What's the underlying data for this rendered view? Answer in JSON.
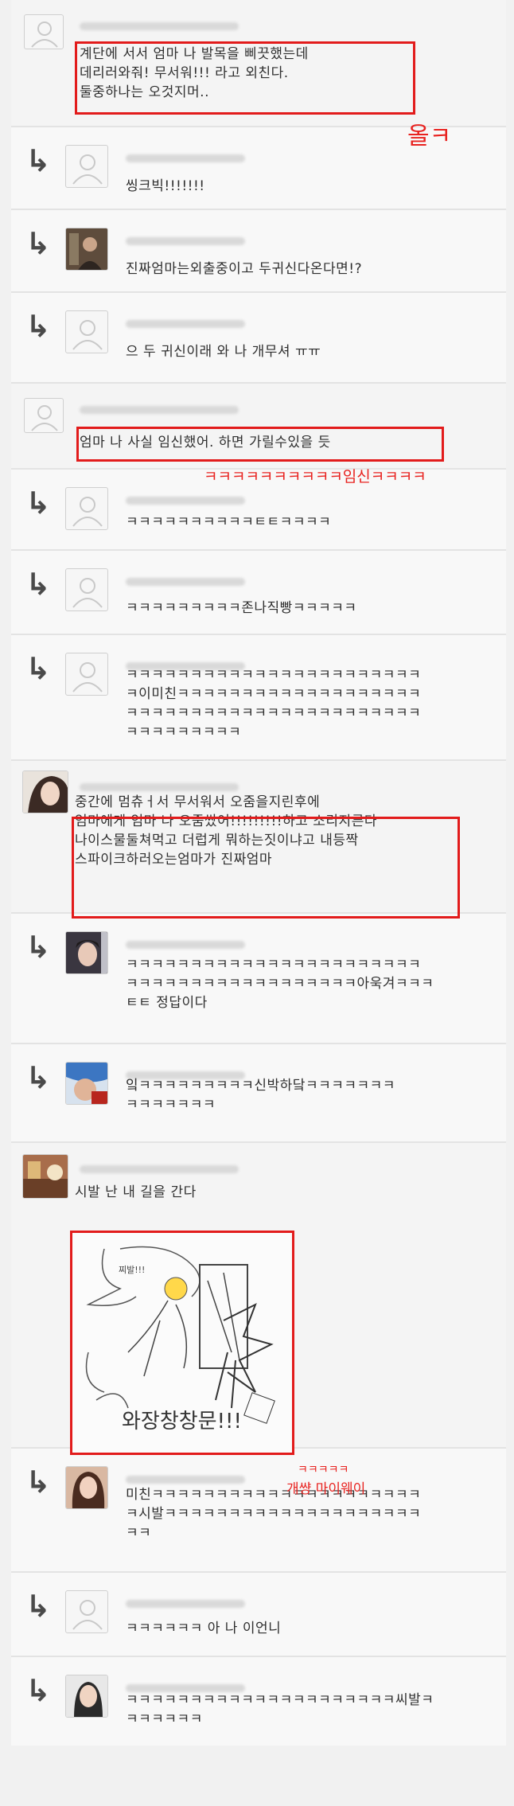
{
  "comments": [
    {
      "type": "top",
      "text": "계단에 서서 엄마 나 발목을 삐끗했는데\n데리러와줘! 무서워!!! 라고 외친다.\n둘중하나는 오것지머.."
    },
    {
      "type": "reply",
      "text": "씽크빅!!!!!!!"
    },
    {
      "type": "reply",
      "text": "진짜엄마는외출중이고 두귀신다온다면!?"
    },
    {
      "type": "reply",
      "text": "으 두 귀신이래 와 나 개무셔 ㅠㅠ"
    },
    {
      "type": "top",
      "text": "엄마 나 사실 임신했어. 하면 가릴수있을 듯"
    },
    {
      "type": "reply",
      "text": "ㅋㅋㅋㅋㅋㅋㅋㅋㅋㅋㅌㅌㅋㅋㅋㅋ"
    },
    {
      "type": "reply",
      "text": "ㅋㅋㅋㅋㅋㅋㅋㅋㅋ존나직빵ㅋㅋㅋㅋㅋ"
    },
    {
      "type": "reply",
      "text": "ㅋㅋㅋㅋㅋㅋㅋㅋㅋㅋㅋㅋㅋㅋㅋㅋㅋㅋㅋㅋㅋㅋㅋ\nㅋ이미친ㅋㅋㅋㅋㅋㅋㅋㅋㅋㅋㅋㅋㅋㅋㅋㅋㅋㅋㅋ\nㅋㅋㅋㅋㅋㅋㅋㅋㅋㅋㅋㅋㅋㅋㅋㅋㅋㅋㅋㅋㅋㅋㅋ\nㅋㅋㅋㅋㅋㅋㅋㅋㅋ"
    },
    {
      "type": "top",
      "text": "중간에 멈츄ㅓ서 무서워서 오줌을지린후에\n엄마에게 엄마 나 오줌쌌어!!!!!!!!!하고 소리지른다\n나이스물둘쳐먹고 더럽게 뭐하는짓이냐고 내등짝\n스파이크하러오는엄마가 진짜엄마"
    },
    {
      "type": "reply",
      "text": "ㅋㅋㅋㅋㅋㅋㅋㅋㅋㅋㅋㅋㅋㅋㅋㅋㅋㅋㅋㅋㅋㅋㅋ\nㅋㅋㅋㅋㅋㅋㅋㅋㅋㅋㅋㅋㅋㅋㅋㅋㅋㅋ아욱겨ㅋㅋㅋ\nㅌㅌ 정답이다"
    },
    {
      "type": "reply",
      "text": "잌ㅋㅋㅋㅋㅋㅋㅋㅋㅋ신박하닼ㅋㅋㅋㅋㅋㅋㅋ\nㅋㅋㅋㅋㅋㅋㅋ"
    },
    {
      "type": "top",
      "text": "시발 난 내 길을 간다"
    },
    {
      "type": "reply",
      "text": "미친ㅋㅋㅋㅋㅋㅋㅋㅋㅋㅋㅋㅋㅋㅋㅋㅋㅋㅋㅋㅋㅋ\nㅋ시발ㅋㅋㅋㅋㅋㅋㅋㅋㅋㅋㅋㅋㅋㅋㅋㅋㅋㅋㅋㅋ\nㅋㅋ"
    },
    {
      "type": "reply",
      "text": "ㅋㅋㅋㅋㅋㅋ 아 나 이언니"
    },
    {
      "type": "reply",
      "text": "ㅋㅋㅋㅋㅋㅋㅋㅋㅋㅋㅋㅋㅋㅋㅋㅋㅋㅋㅋㅋㅋ씨발ㅋ\nㅋㅋㅋㅋㅋㅋ"
    }
  ],
  "reply_arrow": "↳",
  "drawing": {
    "speech": "찌발!!!",
    "caption": "와장창창문!!!"
  },
  "annotations": {
    "a1": "올ㅋ",
    "a2": "ㅋㅋㅋㅋㅋㅋㅋㅋㅋㅋ임신ㅋㅋㅋㅋ",
    "a3_line1": "ㅋㅋㅋㅋㅋ",
    "a3_line2": "개썅 마이웨이"
  },
  "colors": {
    "annotation": "#e8221f",
    "background": "#f1f1f1"
  }
}
